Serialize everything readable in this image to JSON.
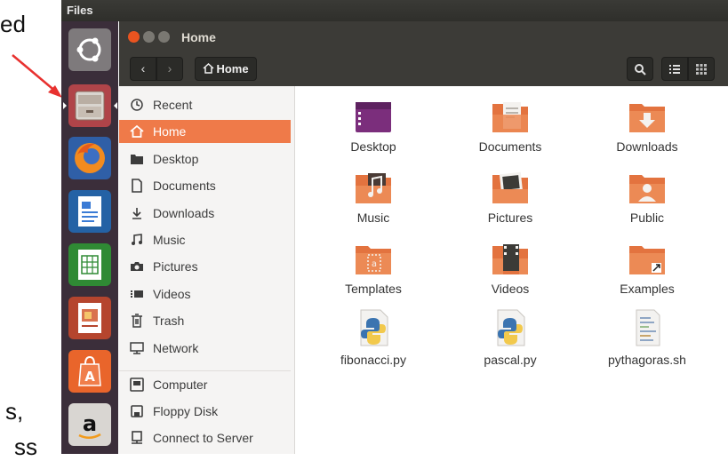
{
  "slide": {
    "fragment_top": "ed",
    "fragment_bottom_1": "s,",
    "fragment_bottom_2": "ss",
    "arrow_color": "#e8312f"
  },
  "top_panel": {
    "title": "Files"
  },
  "launcher": {
    "items": [
      {
        "name": "Ubuntu Dash",
        "icon": "ubuntu-logo-icon"
      },
      {
        "name": "Files",
        "icon": "files-drawer-icon",
        "active": true
      },
      {
        "name": "Firefox",
        "icon": "firefox-icon"
      },
      {
        "name": "LibreOffice Writer",
        "icon": "writer-icon"
      },
      {
        "name": "LibreOffice Calc",
        "icon": "calc-icon"
      },
      {
        "name": "LibreOffice Impress",
        "icon": "impress-icon"
      },
      {
        "name": "Ubuntu Software",
        "icon": "software-center-icon"
      },
      {
        "name": "Amazon",
        "icon": "amazon-icon"
      }
    ]
  },
  "window": {
    "title": "Home",
    "toolbar": {
      "back": "‹",
      "forward": "›",
      "path_label": "Home",
      "search_icon": "search-icon",
      "list_icon": "list-view-icon",
      "grid_icon": "grid-view-icon"
    },
    "sidebar": [
      {
        "label": "Recent",
        "icon": "clock-icon"
      },
      {
        "label": "Home",
        "icon": "home-icon",
        "active": true
      },
      {
        "label": "Desktop",
        "icon": "folder-icon"
      },
      {
        "label": "Documents",
        "icon": "document-icon"
      },
      {
        "label": "Downloads",
        "icon": "download-icon"
      },
      {
        "label": "Music",
        "icon": "music-icon"
      },
      {
        "label": "Pictures",
        "icon": "camera-icon"
      },
      {
        "label": "Videos",
        "icon": "video-icon"
      },
      {
        "label": "Trash",
        "icon": "trash-icon"
      },
      {
        "label": "Network",
        "icon": "network-icon"
      },
      {
        "label": "Computer",
        "icon": "computer-icon"
      },
      {
        "label": "Floppy Disk",
        "icon": "floppy-icon"
      },
      {
        "label": "Connect to Server",
        "icon": "server-icon"
      }
    ],
    "files": [
      {
        "label": "Desktop",
        "icon": "desktop-folder-icon"
      },
      {
        "label": "Documents",
        "icon": "documents-folder-icon"
      },
      {
        "label": "Downloads",
        "icon": "downloads-folder-icon"
      },
      {
        "label": "Music",
        "icon": "music-folder-icon"
      },
      {
        "label": "Pictures",
        "icon": "pictures-folder-icon"
      },
      {
        "label": "Public",
        "icon": "public-folder-icon"
      },
      {
        "label": "Templates",
        "icon": "templates-folder-icon"
      },
      {
        "label": "Videos",
        "icon": "videos-folder-icon"
      },
      {
        "label": "Examples",
        "icon": "examples-folder-icon"
      },
      {
        "label": "fibonacci.py",
        "icon": "python-file-icon"
      },
      {
        "label": "pascal.py",
        "icon": "python-file-icon"
      },
      {
        "label": "pythagoras.sh",
        "icon": "shell-script-icon"
      }
    ]
  },
  "colors": {
    "accent": "#e95420",
    "selection": "#ef7a49",
    "folder": "#e3733f",
    "launcher_bg": "#3b2e3a",
    "titlebar_bg": "#3c3b37"
  }
}
